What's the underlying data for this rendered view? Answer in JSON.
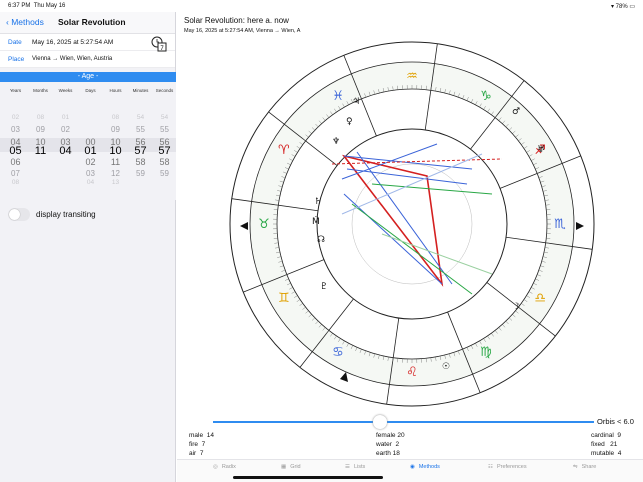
{
  "status": {
    "time": "6:37 PM",
    "date": "Thu May 16",
    "battery": "78%"
  },
  "nav": {
    "back_label": "Methods",
    "title": "Solar Revolution"
  },
  "date_row": {
    "key": "Date",
    "value": "May 16, 2025 at 5:27:54 AM"
  },
  "place_row": {
    "key": "Place",
    "value": "Vienna → Wien, Wien, Austria"
  },
  "age_header": "- Age -",
  "drum": {
    "columns": [
      "Years",
      "Months",
      "Weeks",
      "Days",
      "Hours",
      "Minutes",
      "Seconds"
    ],
    "rows": [
      [
        "02",
        "08",
        "01",
        "",
        "08",
        "54",
        "54"
      ],
      [
        "03",
        "09",
        "02",
        "",
        "09",
        "55",
        "55"
      ],
      [
        "04",
        "10",
        "03",
        "00",
        "10",
        "56",
        "56"
      ],
      [
        "05",
        "11",
        "04",
        "01",
        "10",
        "57",
        "57"
      ],
      [
        "06",
        "",
        "",
        "02",
        "11",
        "58",
        "58"
      ],
      [
        "07",
        "",
        "",
        "03",
        "12",
        "59",
        "59"
      ],
      [
        "08",
        "",
        "",
        "04",
        "13",
        "",
        ""
      ]
    ]
  },
  "toggle_label": "display transiting",
  "chart_header": {
    "title": "Solar Revolution: here a. now",
    "subtitle": "May 16, 2025 at 5:27:54 AM, Vienna → Wien, A"
  },
  "orbis": "Orbis < 6.0",
  "stats": {
    "left": [
      [
        "male",
        "14"
      ],
      [
        "fire",
        "7"
      ],
      [
        "air",
        "7"
      ]
    ],
    "middle": [
      [
        "female",
        "20"
      ],
      [
        "water",
        "2"
      ],
      [
        "earth",
        "18"
      ]
    ],
    "right": [
      [
        "cardinal",
        "9"
      ],
      [
        "fixed",
        "21"
      ],
      [
        "mutable",
        "4"
      ]
    ]
  },
  "tabs": [
    {
      "label": "Radix",
      "icon": "target-icon"
    },
    {
      "label": "Grid",
      "icon": "grid-icon"
    },
    {
      "label": "Lists",
      "icon": "list-icon"
    },
    {
      "label": "Methods",
      "icon": "methods-icon",
      "active": true
    },
    {
      "label": "Preferences",
      "icon": "preferences-icon"
    },
    {
      "label": "Share",
      "icon": "share-icon"
    }
  ],
  "colors": {
    "accent": "#1a73e8",
    "age_bar": "#2f8cf0",
    "aspect_red": "#d42020",
    "aspect_blue": "#3a63d8",
    "aspect_green": "#28a745"
  }
}
